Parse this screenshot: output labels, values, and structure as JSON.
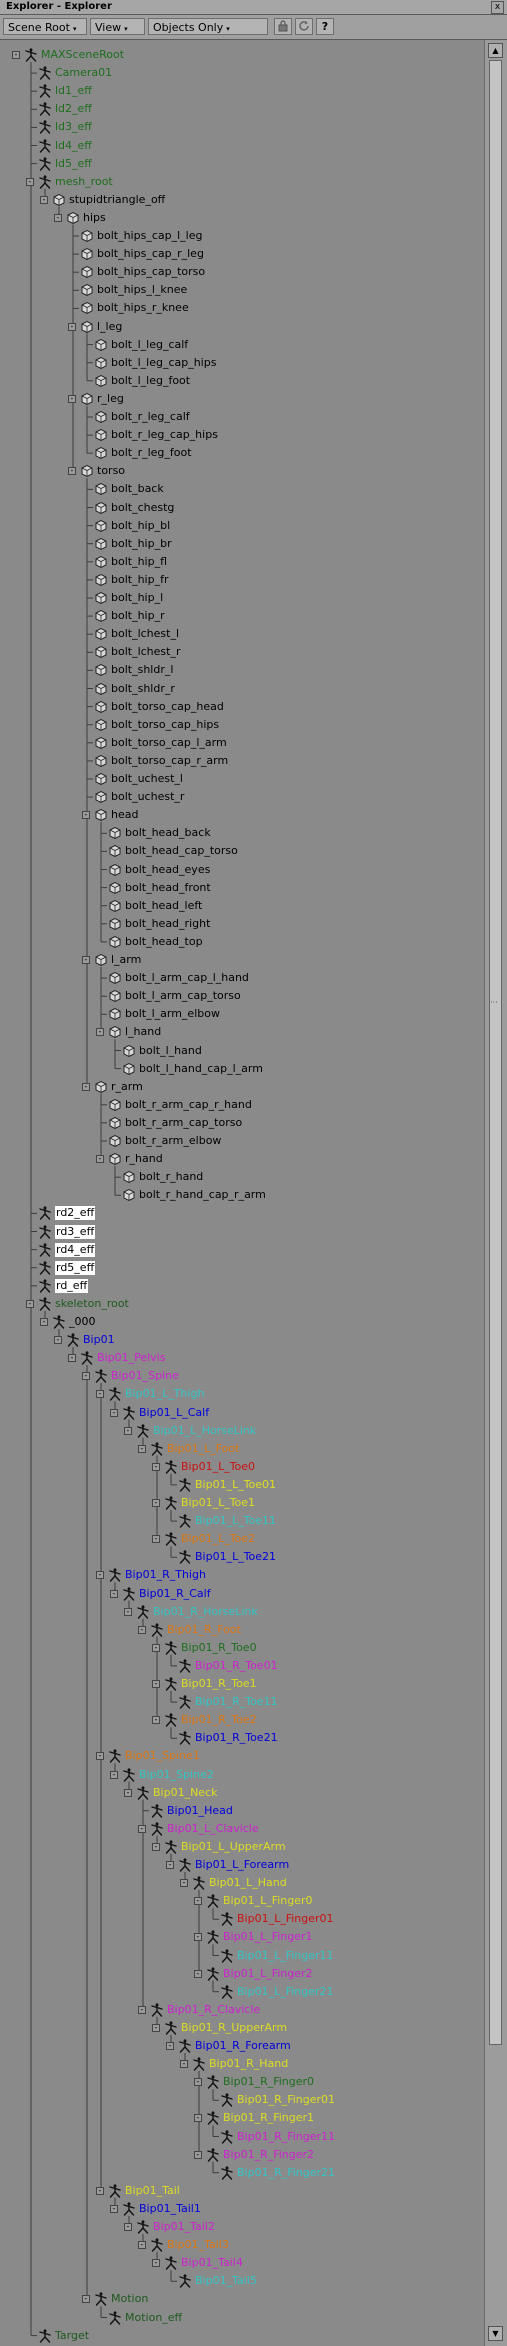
{
  "window": {
    "title": "Explorer - Explorer",
    "close_glyph": "x"
  },
  "toolbar": {
    "scene_root_label": "Scene Root",
    "view_label": "View",
    "filter_label": "Objects Only",
    "lock_icon": "lock-icon",
    "refresh_icon": "refresh-icon",
    "help_icon": "help-icon",
    "help_glyph": "?"
  },
  "colors": {
    "green": "#1e6e1e",
    "darkgreen": "#1e5a1e",
    "black": "#000000",
    "blue": "#0000dd",
    "magenta": "#cc22cc",
    "red": "#cc1111",
    "orange": "#dd7711",
    "yellow": "#dddd22",
    "cyan": "#33c5c5",
    "white": "#ffffff"
  },
  "scrollbar": {
    "up_glyph": "▲",
    "down_glyph": "▼",
    "grip_glyph": "···"
  },
  "tree": [
    {
      "label": "MAXSceneRoot",
      "depth": 0,
      "icon": "skeleton",
      "color": "green",
      "exp": "-"
    },
    {
      "label": "Camera01",
      "depth": 1,
      "icon": "skeleton",
      "color": "green"
    },
    {
      "label": "ld1_eff",
      "depth": 1,
      "icon": "skeleton",
      "color": "green"
    },
    {
      "label": "ld2_eff",
      "depth": 1,
      "icon": "skeleton",
      "color": "green"
    },
    {
      "label": "ld3_eff",
      "depth": 1,
      "icon": "skeleton",
      "color": "green"
    },
    {
      "label": "ld4_eff",
      "depth": 1,
      "icon": "skeleton",
      "color": "green"
    },
    {
      "label": "ld5_eff",
      "depth": 1,
      "icon": "skeleton",
      "color": "green"
    },
    {
      "label": "mesh_root",
      "depth": 1,
      "icon": "skeleton",
      "color": "green",
      "exp": "-"
    },
    {
      "label": "stupidtriangle_off",
      "depth": 2,
      "icon": "mesh",
      "color": "black",
      "exp": "-"
    },
    {
      "label": "hips",
      "depth": 3,
      "icon": "mesh",
      "color": "black",
      "exp": "-"
    },
    {
      "label": "bolt_hips_cap_l_leg",
      "depth": 4,
      "icon": "mesh",
      "color": "black"
    },
    {
      "label": "bolt_hips_cap_r_leg",
      "depth": 4,
      "icon": "mesh",
      "color": "black"
    },
    {
      "label": "bolt_hips_cap_torso",
      "depth": 4,
      "icon": "mesh",
      "color": "black"
    },
    {
      "label": "bolt_hips_l_knee",
      "depth": 4,
      "icon": "mesh",
      "color": "black"
    },
    {
      "label": "bolt_hips_r_knee",
      "depth": 4,
      "icon": "mesh",
      "color": "black"
    },
    {
      "label": "l_leg",
      "depth": 4,
      "icon": "mesh",
      "color": "black",
      "exp": "-"
    },
    {
      "label": "bolt_l_leg_calf",
      "depth": 5,
      "icon": "mesh",
      "color": "black"
    },
    {
      "label": "bolt_l_leg_cap_hips",
      "depth": 5,
      "icon": "mesh",
      "color": "black"
    },
    {
      "label": "bolt_l_leg_foot",
      "depth": 5,
      "icon": "mesh",
      "color": "black"
    },
    {
      "label": "r_leg",
      "depth": 4,
      "icon": "mesh",
      "color": "black",
      "exp": "-"
    },
    {
      "label": "bolt_r_leg_calf",
      "depth": 5,
      "icon": "mesh",
      "color": "black"
    },
    {
      "label": "bolt_r_leg_cap_hips",
      "depth": 5,
      "icon": "mesh",
      "color": "black"
    },
    {
      "label": "bolt_r_leg_foot",
      "depth": 5,
      "icon": "mesh",
      "color": "black"
    },
    {
      "label": "torso",
      "depth": 4,
      "icon": "mesh",
      "color": "black",
      "exp": "-"
    },
    {
      "label": "bolt_back",
      "depth": 5,
      "icon": "mesh",
      "color": "black"
    },
    {
      "label": "bolt_chestg",
      "depth": 5,
      "icon": "mesh",
      "color": "black"
    },
    {
      "label": "bolt_hip_bl",
      "depth": 5,
      "icon": "mesh",
      "color": "black"
    },
    {
      "label": "bolt_hip_br",
      "depth": 5,
      "icon": "mesh",
      "color": "black"
    },
    {
      "label": "bolt_hip_fl",
      "depth": 5,
      "icon": "mesh",
      "color": "black"
    },
    {
      "label": "bolt_hip_fr",
      "depth": 5,
      "icon": "mesh",
      "color": "black"
    },
    {
      "label": "bolt_hip_l",
      "depth": 5,
      "icon": "mesh",
      "color": "black"
    },
    {
      "label": "bolt_hip_r",
      "depth": 5,
      "icon": "mesh",
      "color": "black"
    },
    {
      "label": "bolt_lchest_l",
      "depth": 5,
      "icon": "mesh",
      "color": "black"
    },
    {
      "label": "bolt_lchest_r",
      "depth": 5,
      "icon": "mesh",
      "color": "black"
    },
    {
      "label": "bolt_shldr_l",
      "depth": 5,
      "icon": "mesh",
      "color": "black"
    },
    {
      "label": "bolt_shldr_r",
      "depth": 5,
      "icon": "mesh",
      "color": "black"
    },
    {
      "label": "bolt_torso_cap_head",
      "depth": 5,
      "icon": "mesh",
      "color": "black"
    },
    {
      "label": "bolt_torso_cap_hips",
      "depth": 5,
      "icon": "mesh",
      "color": "black"
    },
    {
      "label": "bolt_torso_cap_l_arm",
      "depth": 5,
      "icon": "mesh",
      "color": "black"
    },
    {
      "label": "bolt_torso_cap_r_arm",
      "depth": 5,
      "icon": "mesh",
      "color": "black"
    },
    {
      "label": "bolt_uchest_l",
      "depth": 5,
      "icon": "mesh",
      "color": "black"
    },
    {
      "label": "bolt_uchest_r",
      "depth": 5,
      "icon": "mesh",
      "color": "black"
    },
    {
      "label": "head",
      "depth": 5,
      "icon": "mesh",
      "color": "black",
      "exp": "-"
    },
    {
      "label": "bolt_head_back",
      "depth": 6,
      "icon": "mesh",
      "color": "black"
    },
    {
      "label": "bolt_head_cap_torso",
      "depth": 6,
      "icon": "mesh",
      "color": "black"
    },
    {
      "label": "bolt_head_eyes",
      "depth": 6,
      "icon": "mesh",
      "color": "black"
    },
    {
      "label": "bolt_head_front",
      "depth": 6,
      "icon": "mesh",
      "color": "black"
    },
    {
      "label": "bolt_head_left",
      "depth": 6,
      "icon": "mesh",
      "color": "black"
    },
    {
      "label": "bolt_head_right",
      "depth": 6,
      "icon": "mesh",
      "color": "black"
    },
    {
      "label": "bolt_head_top",
      "depth": 6,
      "icon": "mesh",
      "color": "black"
    },
    {
      "label": "l_arm",
      "depth": 5,
      "icon": "mesh",
      "color": "black",
      "exp": "-"
    },
    {
      "label": "bolt_l_arm_cap_l_hand",
      "depth": 6,
      "icon": "mesh",
      "color": "black"
    },
    {
      "label": "bolt_l_arm_cap_torso",
      "depth": 6,
      "icon": "mesh",
      "color": "black"
    },
    {
      "label": "bolt_l_arm_elbow",
      "depth": 6,
      "icon": "mesh",
      "color": "black"
    },
    {
      "label": "l_hand",
      "depth": 6,
      "icon": "mesh",
      "color": "black",
      "exp": "-"
    },
    {
      "label": "bolt_l_hand",
      "depth": 7,
      "icon": "mesh",
      "color": "black"
    },
    {
      "label": "bolt_l_hand_cap_l_arm",
      "depth": 7,
      "icon": "mesh",
      "color": "black"
    },
    {
      "label": "r_arm",
      "depth": 5,
      "icon": "mesh",
      "color": "black",
      "exp": "-"
    },
    {
      "label": "bolt_r_arm_cap_r_hand",
      "depth": 6,
      "icon": "mesh",
      "color": "black"
    },
    {
      "label": "bolt_r_arm_cap_torso",
      "depth": 6,
      "icon": "mesh",
      "color": "black"
    },
    {
      "label": "bolt_r_arm_elbow",
      "depth": 6,
      "icon": "mesh",
      "color": "black"
    },
    {
      "label": "r_hand",
      "depth": 6,
      "icon": "mesh",
      "color": "black",
      "exp": "-"
    },
    {
      "label": "bolt_r_hand",
      "depth": 7,
      "icon": "mesh",
      "color": "black"
    },
    {
      "label": "bolt_r_hand_cap_r_arm",
      "depth": 7,
      "icon": "mesh",
      "color": "black"
    },
    {
      "label": "rd2_eff",
      "depth": 1,
      "icon": "skeleton",
      "color": "black",
      "hl": true
    },
    {
      "label": "rd3_eff",
      "depth": 1,
      "icon": "skeleton",
      "color": "black",
      "hl": true
    },
    {
      "label": "rd4_eff",
      "depth": 1,
      "icon": "skeleton",
      "color": "black",
      "hl": true
    },
    {
      "label": "rd5_eff",
      "depth": 1,
      "icon": "skeleton",
      "color": "black",
      "hl": true
    },
    {
      "label": "rd_eff",
      "depth": 1,
      "icon": "skeleton",
      "color": "black",
      "hl": true
    },
    {
      "label": "skeleton_root",
      "depth": 1,
      "icon": "skeleton",
      "color": "darkgreen",
      "exp": "-"
    },
    {
      "label": "_000",
      "depth": 2,
      "icon": "skeleton",
      "color": "black",
      "exp": "-"
    },
    {
      "label": "Bip01",
      "depth": 3,
      "icon": "skeleton",
      "color": "blue",
      "exp": "-"
    },
    {
      "label": "Bip01_Pelvis",
      "depth": 4,
      "icon": "skeleton",
      "color": "magenta",
      "exp": "-"
    },
    {
      "label": "Bip01_Spine",
      "depth": 5,
      "icon": "skeleton",
      "color": "magenta",
      "exp": "-"
    },
    {
      "label": "Bip01_L_Thigh",
      "depth": 6,
      "icon": "skeleton",
      "color": "cyan",
      "exp": "-"
    },
    {
      "label": "Bip01_L_Calf",
      "depth": 7,
      "icon": "skeleton",
      "color": "blue",
      "exp": "-"
    },
    {
      "label": "Bip01_L_HorseLink",
      "depth": 8,
      "icon": "skeleton",
      "color": "cyan",
      "exp": "-"
    },
    {
      "label": "Bip01_L_Foot",
      "depth": 9,
      "icon": "skeleton",
      "color": "orange",
      "exp": "-"
    },
    {
      "label": "Bip01_L_Toe0",
      "depth": 10,
      "icon": "skeleton",
      "color": "red",
      "exp": "-"
    },
    {
      "label": "Bip01_L_Toe01",
      "depth": 11,
      "icon": "skeleton",
      "color": "yellow"
    },
    {
      "label": "Bip01_L_Toe1",
      "depth": 10,
      "icon": "skeleton",
      "color": "yellow",
      "exp": "-"
    },
    {
      "label": "Bip01_L_Toe11",
      "depth": 11,
      "icon": "skeleton",
      "color": "cyan"
    },
    {
      "label": "Bip01_L_Toe2",
      "depth": 10,
      "icon": "skeleton",
      "color": "orange",
      "exp": "-"
    },
    {
      "label": "Bip01_L_Toe21",
      "depth": 11,
      "icon": "skeleton",
      "color": "blue"
    },
    {
      "label": "Bip01_R_Thigh",
      "depth": 6,
      "icon": "skeleton",
      "color": "blue",
      "exp": "-"
    },
    {
      "label": "Bip01_R_Calf",
      "depth": 7,
      "icon": "skeleton",
      "color": "blue",
      "exp": "-"
    },
    {
      "label": "Bip01_R_HorseLink",
      "depth": 8,
      "icon": "skeleton",
      "color": "cyan",
      "exp": "-"
    },
    {
      "label": "Bip01_R_Foot",
      "depth": 9,
      "icon": "skeleton",
      "color": "orange",
      "exp": "-"
    },
    {
      "label": "Bip01_R_Toe0",
      "depth": 10,
      "icon": "skeleton",
      "color": "green",
      "exp": "-"
    },
    {
      "label": "Bip01_R_Toe01",
      "depth": 11,
      "icon": "skeleton",
      "color": "magenta"
    },
    {
      "label": "Bip01_R_Toe1",
      "depth": 10,
      "icon": "skeleton",
      "color": "yellow",
      "exp": "-"
    },
    {
      "label": "Bip01_R_Toe11",
      "depth": 11,
      "icon": "skeleton",
      "color": "cyan"
    },
    {
      "label": "Bip01_R_Toe2",
      "depth": 10,
      "icon": "skeleton",
      "color": "orange",
      "exp": "-"
    },
    {
      "label": "Bip01_R_Toe21",
      "depth": 11,
      "icon": "skeleton",
      "color": "blue"
    },
    {
      "label": "Bip01_Spine1",
      "depth": 6,
      "icon": "skeleton",
      "color": "orange",
      "exp": "-"
    },
    {
      "label": "Bip01_Spine2",
      "depth": 7,
      "icon": "skeleton",
      "color": "cyan",
      "exp": "-"
    },
    {
      "label": "Bip01_Neck",
      "depth": 8,
      "icon": "skeleton",
      "color": "yellow",
      "exp": "-"
    },
    {
      "label": "Bip01_Head",
      "depth": 9,
      "icon": "skeleton",
      "color": "blue"
    },
    {
      "label": "Bip01_L_Clavicle",
      "depth": 9,
      "icon": "skeleton",
      "color": "magenta",
      "exp": "-"
    },
    {
      "label": "Bip01_L_UpperArm",
      "depth": 10,
      "icon": "skeleton",
      "color": "yellow",
      "exp": "-"
    },
    {
      "label": "Bip01_L_Forearm",
      "depth": 11,
      "icon": "skeleton",
      "color": "blue",
      "exp": "-"
    },
    {
      "label": "Bip01_L_Hand",
      "depth": 12,
      "icon": "skeleton",
      "color": "yellow",
      "exp": "-"
    },
    {
      "label": "Bip01_L_Finger0",
      "depth": 13,
      "icon": "skeleton",
      "color": "yellow",
      "exp": "-"
    },
    {
      "label": "Bip01_L_Finger01",
      "depth": 14,
      "icon": "skeleton",
      "color": "red"
    },
    {
      "label": "Bip01_L_Finger1",
      "depth": 13,
      "icon": "skeleton",
      "color": "magenta",
      "exp": "-"
    },
    {
      "label": "Bip01_L_Finger11",
      "depth": 14,
      "icon": "skeleton",
      "color": "cyan"
    },
    {
      "label": "Bip01_L_Finger2",
      "depth": 13,
      "icon": "skeleton",
      "color": "magenta",
      "exp": "-"
    },
    {
      "label": "Bip01_L_Finger21",
      "depth": 14,
      "icon": "skeleton",
      "color": "cyan"
    },
    {
      "label": "Bip01_R_Clavicle",
      "depth": 9,
      "icon": "skeleton",
      "color": "magenta",
      "exp": "-"
    },
    {
      "label": "Bip01_R_UpperArm",
      "depth": 10,
      "icon": "skeleton",
      "color": "yellow",
      "exp": "-"
    },
    {
      "label": "Bip01_R_Forearm",
      "depth": 11,
      "icon": "skeleton",
      "color": "blue",
      "exp": "-"
    },
    {
      "label": "Bip01_R_Hand",
      "depth": 12,
      "icon": "skeleton",
      "color": "yellow",
      "exp": "-"
    },
    {
      "label": "Bip01_R_Finger0",
      "depth": 13,
      "icon": "skeleton",
      "color": "green",
      "exp": "-"
    },
    {
      "label": "Bip01_R_Finger01",
      "depth": 14,
      "icon": "skeleton",
      "color": "yellow"
    },
    {
      "label": "Bip01_R_Finger1",
      "depth": 13,
      "icon": "skeleton",
      "color": "yellow",
      "exp": "-"
    },
    {
      "label": "Bip01_R_Finger11",
      "depth": 14,
      "icon": "skeleton",
      "color": "magenta"
    },
    {
      "label": "Bip01_R_Finger2",
      "depth": 13,
      "icon": "skeleton",
      "color": "magenta",
      "exp": "-"
    },
    {
      "label": "Bip01_R_Finger21",
      "depth": 14,
      "icon": "skeleton",
      "color": "cyan"
    },
    {
      "label": "Bip01_Tail",
      "depth": 6,
      "icon": "skeleton",
      "color": "yellow",
      "exp": "-"
    },
    {
      "label": "Bip01_Tail1",
      "depth": 7,
      "icon": "skeleton",
      "color": "blue",
      "exp": "-"
    },
    {
      "label": "Bip01_Tail2",
      "depth": 8,
      "icon": "skeleton",
      "color": "magenta",
      "exp": "-"
    },
    {
      "label": "Bip01_Tail3",
      "depth": 9,
      "icon": "skeleton",
      "color": "orange",
      "exp": "-"
    },
    {
      "label": "Bip01_Tail4",
      "depth": 10,
      "icon": "skeleton",
      "color": "magenta",
      "exp": "-"
    },
    {
      "label": "Bip01_Tail5",
      "depth": 11,
      "icon": "skeleton",
      "color": "cyan"
    },
    {
      "label": "Motion",
      "depth": 5,
      "icon": "skeleton",
      "color": "darkgreen",
      "exp": "-"
    },
    {
      "label": "Motion_eff",
      "depth": 6,
      "icon": "skeleton",
      "color": "darkgreen"
    },
    {
      "label": "Target",
      "depth": 1,
      "icon": "skeleton",
      "color": "darkgreen"
    }
  ]
}
